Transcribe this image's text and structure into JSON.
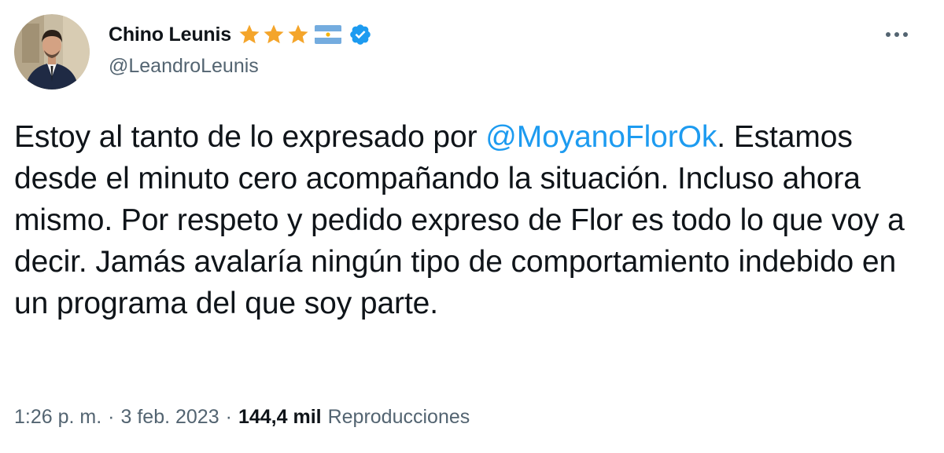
{
  "author": {
    "display_name": "Chino Leunis",
    "handle": "@LeandroLeunis",
    "badges": {
      "stars": 3,
      "star_color": "#f4a52b",
      "flag_icon": "argentina-flag-icon",
      "verified_icon": "verified-badge-icon",
      "verified_color": "#1d9bf0"
    }
  },
  "tweet": {
    "text_before": "Estoy al tanto de lo expresado por ",
    "mention": "@MoyanoFlorOk",
    "text_after": ". Estamos desde el minuto cero acompañando la situación. Incluso ahora mismo. Por respeto y pedido expreso de Flor es todo lo que voy a decir. Jamás avalaría ningún tipo de comportamiento indebido en un programa del que soy parte."
  },
  "meta": {
    "time": "1:26 p. m.",
    "separator": "·",
    "date": "3 feb. 2023",
    "views_count": "144,4 mil",
    "views_label": "Reproducciones"
  },
  "icons": {
    "more": "more-options-icon"
  },
  "colors": {
    "text": "#0f1419",
    "secondary": "#536471",
    "link": "#1d9bf0"
  }
}
